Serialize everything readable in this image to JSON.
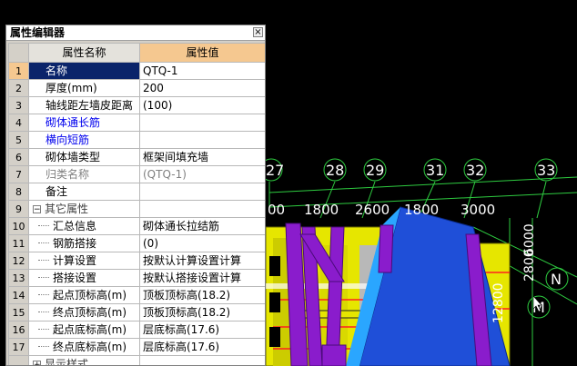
{
  "panel": {
    "title": "属性编辑器",
    "close_glyph": "×",
    "header_name": "属性名称",
    "header_value": "属性值",
    "rows": [
      {
        "idx": "1",
        "name": "名称",
        "value": "QTQ-1"
      },
      {
        "idx": "2",
        "name": "厚度(mm)",
        "value": "200"
      },
      {
        "idx": "3",
        "name": "轴线距左墙皮距离",
        "value": "(100)"
      },
      {
        "idx": "4",
        "name": "砌体通长筋",
        "value": ""
      },
      {
        "idx": "5",
        "name": "横向短筋",
        "value": ""
      },
      {
        "idx": "6",
        "name": "砌体墙类型",
        "value": "框架间填充墙"
      },
      {
        "idx": "7",
        "name": "归类名称",
        "value": "(QTQ-1)"
      },
      {
        "idx": "8",
        "name": "备注",
        "value": ""
      },
      {
        "idx": "9",
        "name": "其它属性",
        "value": "",
        "toggle": "−"
      },
      {
        "idx": "10",
        "name": "汇总信息",
        "value": "砌体通长拉结筋"
      },
      {
        "idx": "11",
        "name": "钢筋搭接",
        "value": "(0)"
      },
      {
        "idx": "12",
        "name": "计算设置",
        "value": "按默认计算设置计算"
      },
      {
        "idx": "13",
        "name": "搭接设置",
        "value": "按默认搭接设置计算"
      },
      {
        "idx": "14",
        "name": "起点顶标高(m)",
        "value": "顶板顶标高(18.2)"
      },
      {
        "idx": "15",
        "name": "终点顶标高(m)",
        "value": "顶板顶标高(18.2)"
      },
      {
        "idx": "16",
        "name": "起点底标高(m)",
        "value": "层底标高(17.6)"
      },
      {
        "idx": "17",
        "name": "终点底标高(m)",
        "value": "层底标高(17.6)"
      },
      {
        "idx": "",
        "name": "显示样式",
        "value": "",
        "toggle": "+"
      }
    ]
  },
  "viewport": {
    "axis_labels": [
      "27",
      "28",
      "29",
      "31",
      "32",
      "33",
      "N",
      "M"
    ],
    "dimensions_top": [
      "00",
      "1800",
      "2600",
      "1800",
      "3000"
    ],
    "dimensions_side": [
      "2800",
      "12800",
      "6000"
    ],
    "colors": {
      "wall_yellow": "#e6e600",
      "column_purple": "#8a1ccc",
      "slab_blue": "#1f4fd8",
      "axis_green": "#2ecc40",
      "rebar_red": "#ff2020"
    }
  }
}
